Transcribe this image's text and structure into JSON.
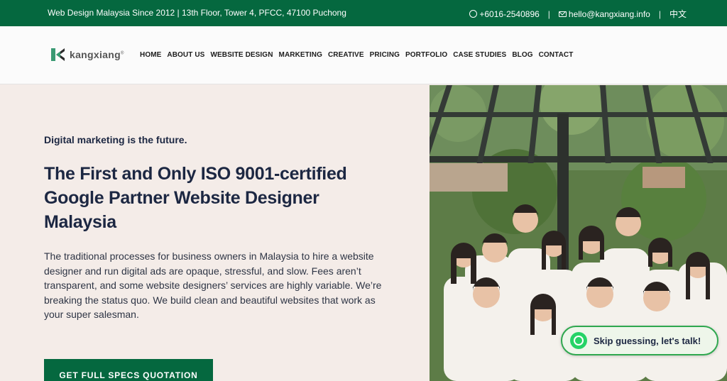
{
  "topbar": {
    "address": "Web Design Malaysia Since 2012 | 13th Floor, Tower 4, PFCC, 47100 Puchong",
    "phone": "+6016-2540896",
    "email": "hello@kangxiang.info",
    "language": "中文"
  },
  "header": {
    "logo_text": "kangxiang",
    "nav": [
      "HOME",
      "ABOUT US",
      "WEBSITE DESIGN",
      "MARKETING",
      "CREATIVE",
      "PRICING",
      "PORTFOLIO",
      "CASE STUDIES",
      "BLOG",
      "CONTACT"
    ]
  },
  "hero": {
    "tagline": "Digital marketing is the future.",
    "headline": "The First and Only ISO 9001-certified Google Partner Website Designer Malaysia",
    "body": "The traditional processes for business owners in Malaysia to hire a website designer and run digital ads are opaque, stressful, and slow. Fees aren’t transparent, and some website designers’ services are highly variable. We’re breaking the status quo. We build clean and beautiful websites that work as your super salesman.",
    "cta": "GET FULL SPECS QUOTATION"
  },
  "whatsapp": {
    "label": "Skip guessing, let's talk!"
  },
  "colors": {
    "brand_green": "#05683f",
    "navy": "#1c2742",
    "hero_bg": "#f4ece8",
    "whatsapp_green": "#25d366"
  }
}
